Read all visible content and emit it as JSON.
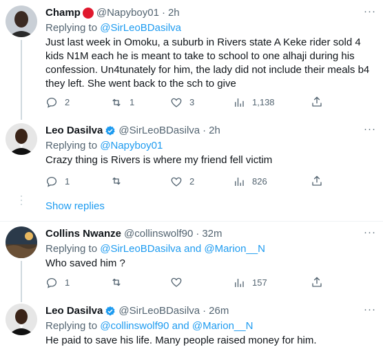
{
  "tweets": [
    {
      "name": "Champ",
      "has_emoji": true,
      "handle": "@Napyboy01",
      "time": "2h",
      "replying_prefix": "Replying to ",
      "replying_to": "@SirLeoBDasilva",
      "text": "Just last week in Omoku, a suburb in Rivers state A Keke rider sold 4 kids N1M each he is meant to take to school to one alhaji during his confession. Un4tunately for him, the lady did not include their meals b4 they left. She went back to the sch to give",
      "replies": "2",
      "retweets": "1",
      "likes": "3",
      "views": "1,138"
    },
    {
      "name": "Leo Dasilva",
      "verified": true,
      "handle": "@SirLeoBDasilva",
      "time": "2h",
      "replying_prefix": "Replying to ",
      "replying_to": "@Napyboy01",
      "text": "Crazy thing is Rivers is where my friend fell victim",
      "replies": "1",
      "retweets": "",
      "likes": "2",
      "views": "826"
    },
    {
      "name": "Collins Nwanze",
      "handle": "@collinswolf90",
      "time": "32m",
      "replying_prefix": "Replying to ",
      "replying_to": "@SirLeoBDasilva and @Marion__N",
      "text": "Who saved him ?",
      "replies": "1",
      "retweets": "",
      "likes": "",
      "views": "157"
    },
    {
      "name": "Leo Dasilva",
      "verified": true,
      "handle": "@SirLeoBDasilva",
      "time": "26m",
      "replying_prefix": "Replying to ",
      "replying_to": "@collinswolf90 and @Marion__N",
      "text": "He paid to save his life. Many people raised money for him."
    }
  ],
  "show_replies": "Show replies",
  "more_icon": "···",
  "separator": "·",
  "colors": {
    "link": "#1d9bf0",
    "secondary": "#536471",
    "verified": "#1d9bf0",
    "emoji_red": "#e0182d"
  },
  "icons": [
    "reply-icon",
    "retweet-icon",
    "like-icon",
    "views-icon",
    "share-icon",
    "verified-badge-icon",
    "more-icon"
  ]
}
